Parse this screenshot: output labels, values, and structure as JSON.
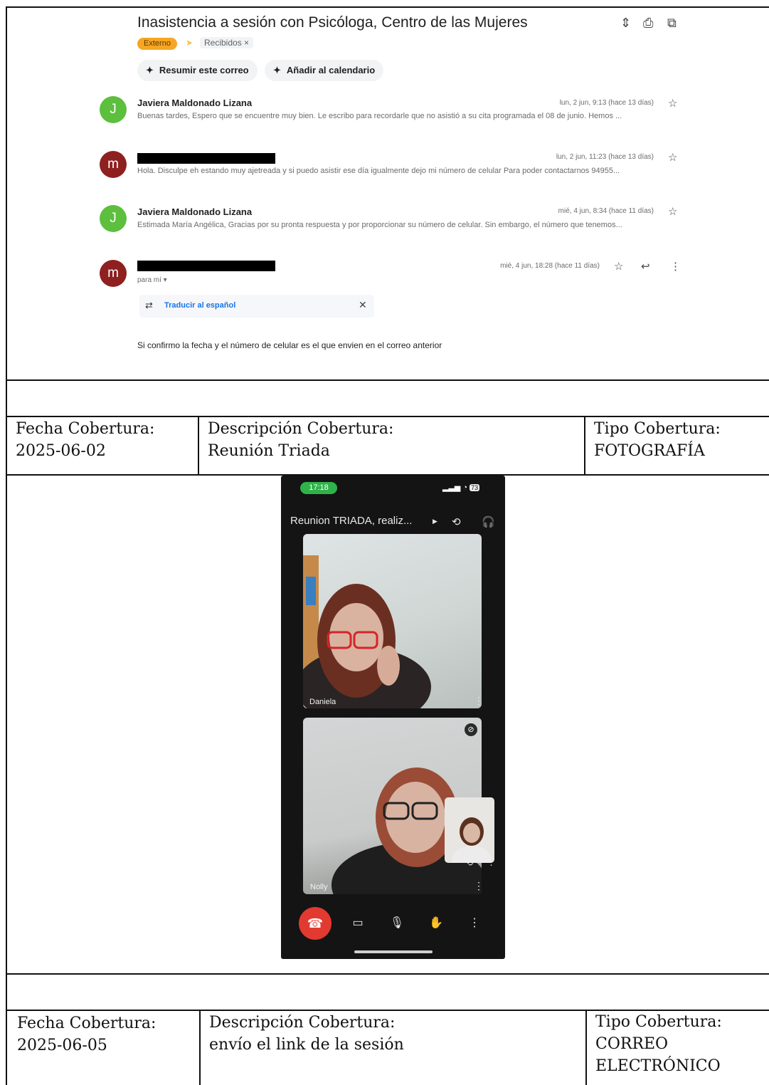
{
  "email": {
    "subject": "Inasistencia a sesión con Psicóloga, Centro de las Mujeres",
    "label_external": "Externo",
    "label_inbox": "Recibidos ×",
    "actions": [
      "Resumir este correo",
      "Añadir al calendario"
    ],
    "messages": [
      {
        "avatar": "J",
        "sender": "Javiera Maldonado Lizana",
        "date": "lun, 2 jun, 9:13 (hace 13 días)",
        "snippet": "Buenas tardes, Espero que se encuentre muy bien. Le escribo para recordarle que no asistió a su cita programada el 08 de junio. Hemos ..."
      },
      {
        "avatar": "m",
        "sender": "",
        "date": "lun, 2 jun, 11:23 (hace 13 días)",
        "snippet": "Hola. Disculpe eh estando muy ajetreada y si puedo asistir ese día igualmente dejo mi número de celular Para poder contactarnos 94955..."
      },
      {
        "avatar": "J",
        "sender": "Javiera Maldonado Lizana",
        "date": "mié, 4 jun, 8:34 (hace 11 días)",
        "snippet": "Estimada María Angélica, Gracias por su pronta respuesta y por proporcionar su número de celular. Sin embargo, el número que tenemos..."
      },
      {
        "avatar": "m",
        "sender": "",
        "date": "mié, 4 jun, 18:28 (hace 11 días)",
        "to": "para mí ▾"
      }
    ],
    "translate_label": "Traducir al español",
    "body": "Si confirmo la fecha y el número de celular es el que envien en el correo anterior"
  },
  "rows": [
    {
      "fecha_label": "Fecha Cobertura:",
      "fecha": "2025-06-02",
      "desc_label": "Descripción Cobertura:",
      "desc": "Reunión Triada",
      "tipo_label": "Tipo Cobertura:",
      "tipo": "FOTOGRAFÍA"
    },
    {
      "fecha_label": "Fecha Cobertura:",
      "fecha": "2025-06-05",
      "desc_label": "Descripción Cobertura:",
      "desc": "envío el link de la sesión",
      "tipo_label": "Tipo Cobertura:",
      "tipo_1": "CORREO",
      "tipo_2": "ELECTRÓNICO"
    }
  ],
  "phone": {
    "time": "17:18",
    "battery": "73",
    "meeting_title": "Reunion TRIADA, realiz...",
    "participants": [
      "Daniela",
      "Nolly"
    ]
  }
}
